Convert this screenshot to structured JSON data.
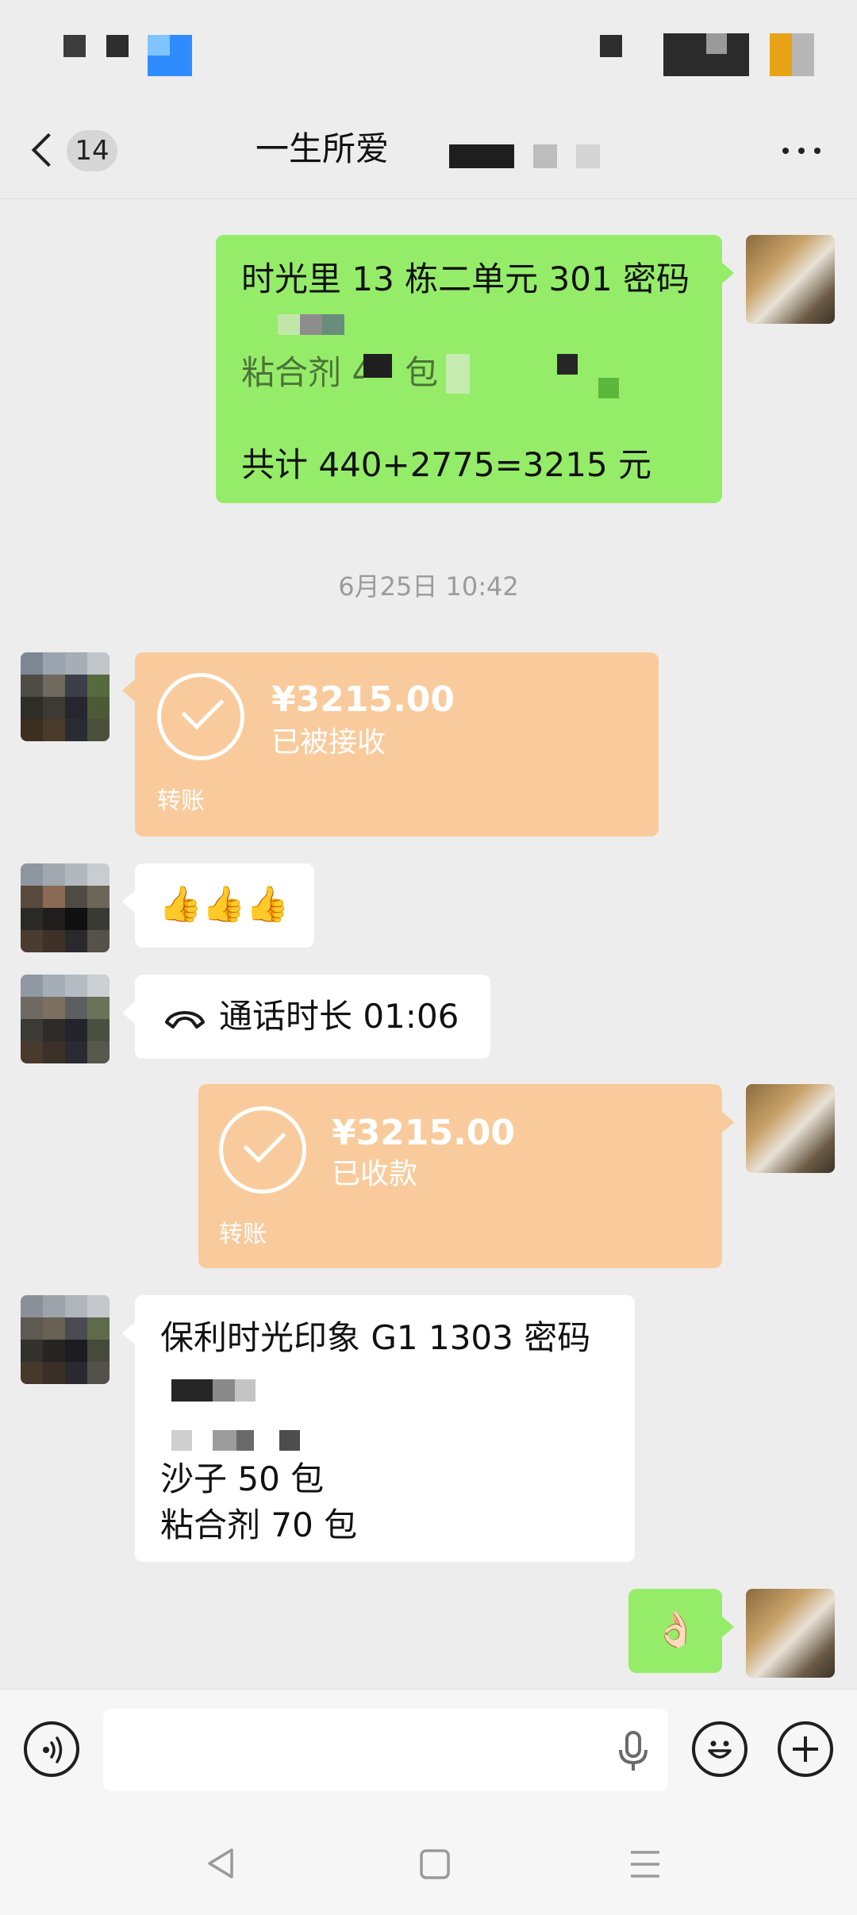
{
  "header": {
    "back_badge": "14",
    "title": "一生所爱"
  },
  "messages": {
    "m1": {
      "line1": "时光里 13 栋二单元 301 密码",
      "line3": "粘合剂 40 包",
      "line5": "共计 440+2775=3215 元"
    },
    "timestamp": "6月25日 10:42",
    "m2": {
      "amount": "¥3215.00",
      "status": "已被接收",
      "type_label": "转账"
    },
    "m3": {
      "emoji": "👍👍👍"
    },
    "m4": {
      "call_text": "通话时长 01:06"
    },
    "m5": {
      "amount": "¥3215.00",
      "status": "已收款",
      "type_label": "转账"
    },
    "m6": {
      "line1": "保利时光印象 G1  1303 密码",
      "line4": "沙子 50 包",
      "line5": "粘合剂 70 包"
    },
    "m7": {
      "emoji": "👌🏻"
    }
  },
  "icons": {
    "voice_toggle": "voice-icon",
    "mic": "mic-icon",
    "emoji": "emoji-icon",
    "plus": "plus-icon"
  },
  "colors": {
    "background": "#ededed",
    "sent_bubble": "#95ec69",
    "received_bubble": "#ffffff",
    "transfer_card": "#f9cb9c"
  }
}
